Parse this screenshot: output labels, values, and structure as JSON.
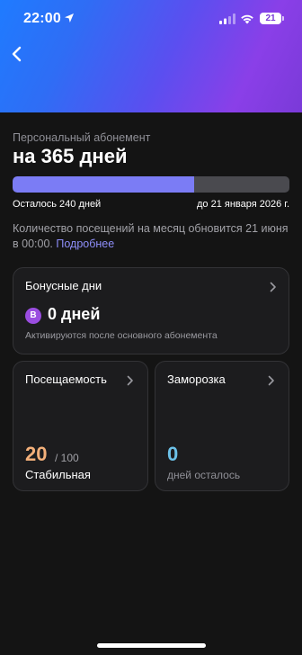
{
  "status_bar": {
    "time": "22:00",
    "battery": "21",
    "icons": [
      "location-arrow-icon",
      "signal-icon",
      "wifi-icon",
      "battery-icon"
    ]
  },
  "nav": {
    "back_icon": "chevron-left-icon"
  },
  "membership": {
    "subtitle": "Персональный абонемент",
    "title": "на 365 дней",
    "progress_fraction": 0.655,
    "remaining": "Осталось 240 дней",
    "until": "до 21 января 2026 г."
  },
  "note": {
    "text": "Количество посещений на месяц обновится 21 июня в 00:00.",
    "link": "Подробнее"
  },
  "bonus_card": {
    "title": "Бонусные дни",
    "badge": "B",
    "value": "0 дней",
    "hint": "Активируются после основного абонемента"
  },
  "attendance_card": {
    "title": "Посещаемость",
    "value": "20",
    "max": "/ 100",
    "status": "Стабильная"
  },
  "freeze_card": {
    "title": "Заморозка",
    "value": "0",
    "label": "дней осталось"
  },
  "colors": {
    "background": "#141414",
    "card": "#1c1c1e",
    "accent": "#7b7cf5",
    "link": "#8e8ef9",
    "attendance": "#f3b07a",
    "freeze": "#6cc1e8",
    "badge": "#9a4de0"
  }
}
